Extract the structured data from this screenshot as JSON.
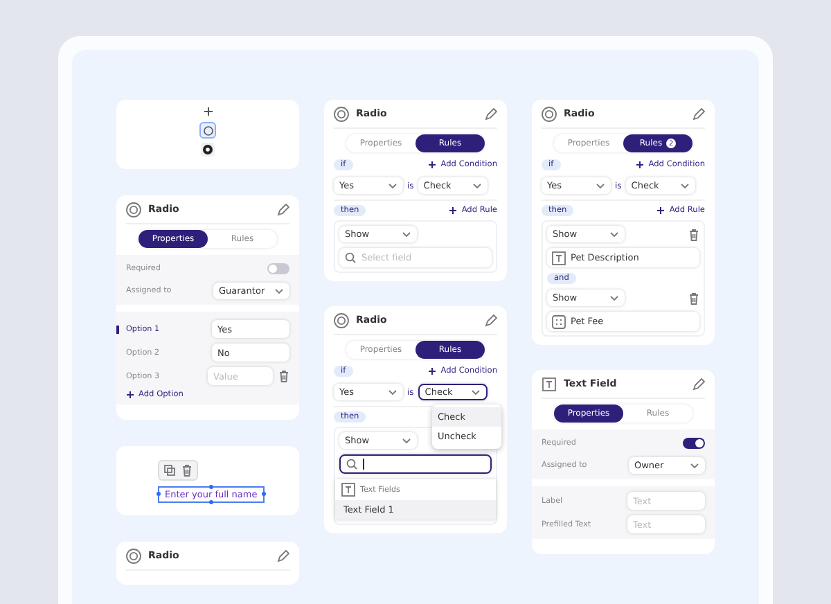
{
  "columns": [
    [
      {
        "kind": "toolbox",
        "items": [
          {
            "kind": "plus",
            "selected": false
          },
          {
            "kind": "radio-empty",
            "selected": true
          },
          {
            "kind": "radio-filled",
            "selected": false
          }
        ]
      },
      {
        "kind": "radio-properties",
        "title": "Radio",
        "tabs": [
          {
            "label": "Properties",
            "selected": true
          },
          {
            "label": "Rules",
            "selected": false
          }
        ],
        "settings": {
          "required_label": "Required",
          "required_on": false,
          "assigned_label": "Assigned to",
          "assigned_value": "Guarantor"
        },
        "options": [
          {
            "label": "Option 1",
            "value": "Yes",
            "selected": true,
            "deletable": false
          },
          {
            "label": "Option 2",
            "value": "No",
            "selected": false,
            "deletable": false
          },
          {
            "label": "Option 3",
            "placeholder": "Value",
            "selected": false,
            "deletable": true
          }
        ],
        "add_option": "Add Option"
      },
      {
        "kind": "element",
        "text": "Enter your full name"
      },
      {
        "kind": "radio-properties",
        "title": "Radio"
      }
    ],
    [
      {
        "kind": "radio-rules",
        "title": "Radio",
        "tabs": [
          {
            "label": "Properties",
            "selected": false
          },
          {
            "label": "Rules",
            "selected": true
          }
        ],
        "if_label": "if",
        "add_condition": "Add Condition",
        "condition": {
          "left": "Yes",
          "op": "is",
          "right": "Check",
          "focused": false
        },
        "then_label": "then",
        "add_rule": "Add Rule",
        "actions": [
          {
            "action": "Show",
            "deletable": false,
            "search": {
              "placeholder": "Select field",
              "focused": false
            }
          }
        ]
      },
      {
        "kind": "radio-rules",
        "title": "Radio",
        "tabs": [
          {
            "label": "Properties",
            "selected": false
          },
          {
            "label": "Rules",
            "selected": true
          }
        ],
        "if_label": "if",
        "add_condition": "Add Condition",
        "condition": {
          "left": "Yes",
          "op": "is",
          "right": "Check",
          "focused": true,
          "menu": [
            {
              "label": "Check",
              "selected": true
            },
            {
              "label": "Uncheck",
              "selected": false
            }
          ]
        },
        "then_label": "then",
        "actions": [
          {
            "action": "Show",
            "search": {
              "focused": true,
              "results": {
                "group": "Text Fields",
                "items": [
                  {
                    "label": "Text Field 1",
                    "selected": true
                  }
                ]
              }
            }
          }
        ]
      }
    ],
    [
      {
        "kind": "radio-rules",
        "title": "Radio",
        "tabs": [
          {
            "label": "Properties",
            "selected": false
          },
          {
            "label": "Rules",
            "selected": true,
            "badge": "2"
          }
        ],
        "if_label": "if",
        "add_condition": "Add Condition",
        "condition": {
          "left": "Yes",
          "op": "is",
          "right": "Check",
          "focused": false
        },
        "then_label": "then",
        "add_rule": "Add Rule",
        "joiner": "and",
        "actions": [
          {
            "action": "Show",
            "deletable": true,
            "target": {
              "kind": "text-field",
              "text": "Pet Description"
            }
          },
          {
            "action": "Show",
            "deletable": true,
            "target": {
              "kind": "number-field",
              "text": "Pet Fee"
            }
          }
        ]
      },
      {
        "kind": "text-properties",
        "title": "Text Field",
        "tabs": [
          {
            "label": "Properties",
            "selected": true
          },
          {
            "label": "Rules",
            "selected": false
          }
        ],
        "settings": {
          "required_label": "Required",
          "required_on": true,
          "assigned_label": "Assigned to",
          "assigned_value": "Owner"
        },
        "fields": [
          {
            "label": "Label",
            "placeholder": "Text"
          },
          {
            "label": "Prefilled Text",
            "placeholder": "Text"
          }
        ]
      }
    ]
  ]
}
